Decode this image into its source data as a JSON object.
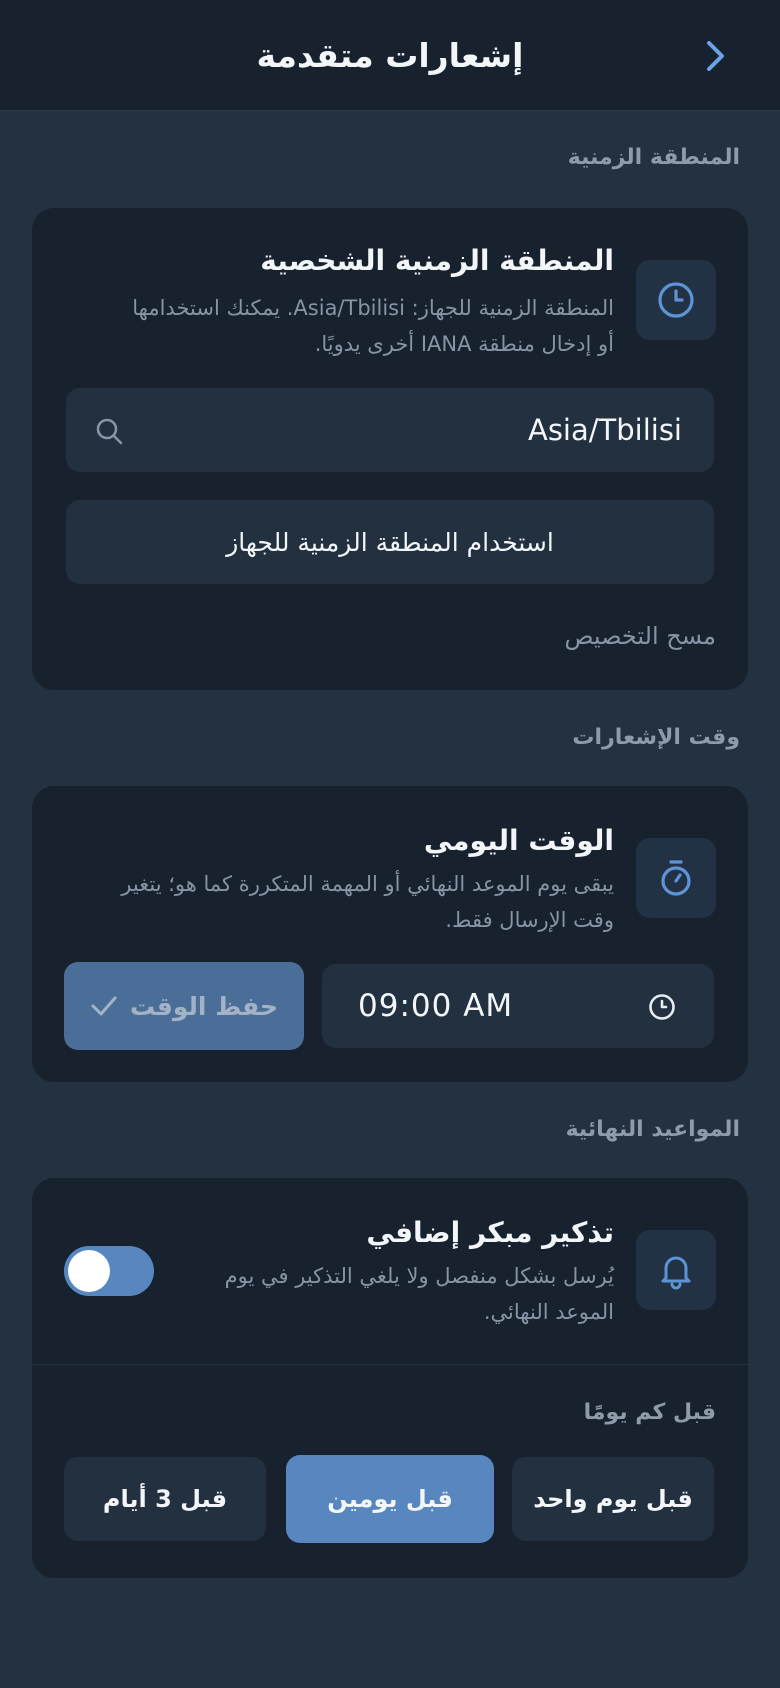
{
  "header": {
    "title": "إشعارات متقدمة"
  },
  "sections": {
    "timezone": "المنطقة الزمنية",
    "notify_time": "وقت الإشعارات",
    "deadlines": "المواعيد النهائية"
  },
  "timezone_card": {
    "title": "المنطقة الزمنية الشخصية",
    "desc_line1": "المنطقة الزمنية للجهاز: Asia/Tbilisi. يمكنك استخدامها",
    "desc_line2": "أو إدخال منطقة IANA أخرى يدويًا.",
    "input_value": "Asia/Tbilisi",
    "use_device_label": "استخدام المنطقة الزمنية للجهاز",
    "clear_label": "مسح التخصيص"
  },
  "daily_card": {
    "title": "الوقت اليومي",
    "desc_line1": "يبقى يوم الموعد النهائي أو المهمة المتكررة كما هو؛ يتغير",
    "desc_line2": "وقت الإرسال فقط.",
    "time_value": "09:00 AM",
    "save_label": "حفظ الوقت"
  },
  "reminder_card": {
    "title": "تذكير مبكر إضافي",
    "desc_line1": "يُرسل بشكل منفصل ولا يلغي التذكير في يوم",
    "desc_line2": "الموعد النهائي.",
    "toggle_on": true,
    "days_label": "قبل كم يومًا",
    "options": [
      "قبل يوم واحد",
      "قبل يومين",
      "قبل 3 أيام"
    ],
    "selected_option": "قبل يومين"
  },
  "colors": {
    "background": "#243140",
    "card": "#17222e",
    "accent": "#5887c0"
  },
  "icons": [
    "chevron-right-icon",
    "clock-icon",
    "search-icon",
    "timer-icon",
    "check-icon",
    "bell-icon"
  ]
}
